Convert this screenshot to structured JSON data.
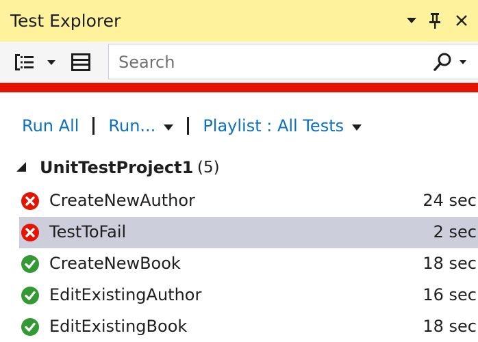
{
  "window": {
    "title": "Test Explorer"
  },
  "toolbar": {
    "group_by_icon": "group-by-icon",
    "playlist_icon": "playlist-icon",
    "search_placeholder": "Search",
    "search_value": ""
  },
  "status": {
    "progress_percent": 100,
    "color": "#e51400"
  },
  "commands": {
    "run_all": "Run All",
    "run": "Run...",
    "playlist": "Playlist : All Tests"
  },
  "group": {
    "name": "UnitTestProject1",
    "count": "(5)"
  },
  "tests": [
    {
      "name": "CreateNewAuthor",
      "status": "failed",
      "duration": "24 sec",
      "selected": false
    },
    {
      "name": "TestToFail",
      "status": "failed",
      "duration": "2 sec",
      "selected": true
    },
    {
      "name": "CreateNewBook",
      "status": "passed",
      "duration": "18 sec",
      "selected": false
    },
    {
      "name": "EditExistingAuthor",
      "status": "passed",
      "duration": "16 sec",
      "selected": false
    },
    {
      "name": "EditExistingBook",
      "status": "passed",
      "duration": "18 sec",
      "selected": false
    }
  ],
  "colors": {
    "title_bg": "#fff29d",
    "link": "#0e70c0",
    "fail": "#e51400",
    "pass": "#339933",
    "selection": "#cccedb"
  }
}
